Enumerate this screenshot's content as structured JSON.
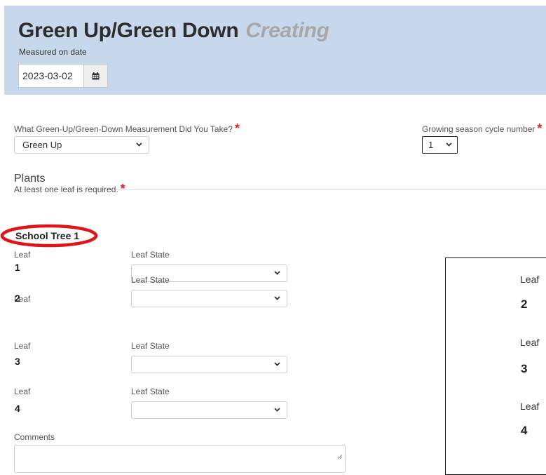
{
  "header": {
    "title": "Green Up/Green Down",
    "status": "Creating",
    "measured_label": "Measured on date",
    "date_value": "2023-03-02"
  },
  "measurement": {
    "question": "What Green-Up/Green-Down Measurement Did You Take?",
    "selected": "Green Up"
  },
  "cycle": {
    "label": "Growing season cycle number",
    "selected": "1"
  },
  "plants": {
    "title": "Plants",
    "requirement": "At least one leaf is required.",
    "tree_name": "School Tree 1",
    "leaves": [
      {
        "leaf_label": "Leaf",
        "number": "1",
        "state_label": "Leaf State",
        "state_value": ""
      },
      {
        "leaf_label": "Leaf",
        "number": "2",
        "state_label": "Leaf State",
        "state_value": ""
      },
      {
        "leaf_label": "Leaf",
        "number": "3",
        "state_label": "Leaf State",
        "state_value": ""
      },
      {
        "leaf_label": "Leaf",
        "number": "4",
        "state_label": "Leaf State",
        "state_value": ""
      }
    ],
    "comments_label": "Comments",
    "comments_value": ""
  },
  "required_marker": "*",
  "zoom_callout": {
    "items": [
      {
        "label": "Leaf",
        "number": "2"
      },
      {
        "label": "Leaf",
        "number": "3"
      },
      {
        "label": "Leaf",
        "number": "4"
      }
    ]
  },
  "colors": {
    "header_bg": "#c7d8ec",
    "required": "#d9261c",
    "annotation_ring": "#e0141b",
    "status_text": "#a7a7a7"
  },
  "icons": {
    "calendar": "calendar-icon",
    "dropdown": "chevron-down-icon",
    "resize": "resize-handle-icon"
  }
}
